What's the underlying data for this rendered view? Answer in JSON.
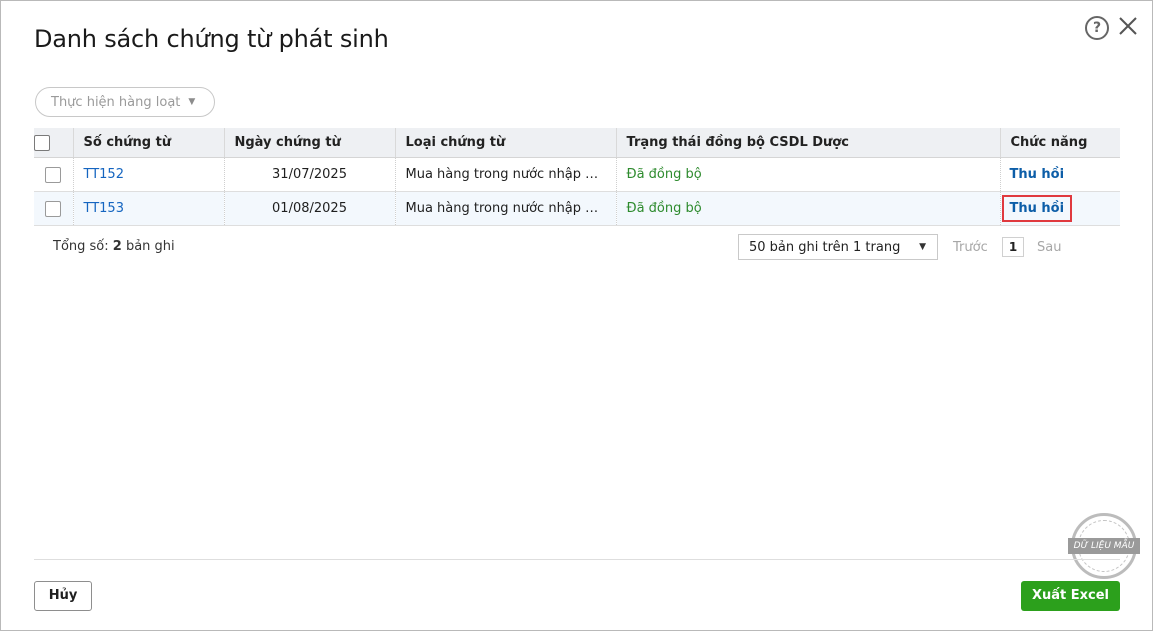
{
  "dialog": {
    "title": "Danh sách chứng từ phát sinh",
    "help_icon": "?",
    "close_icon": "close-icon"
  },
  "toolbar": {
    "bulk_action_label": "Thực hiện hàng loạt"
  },
  "table": {
    "columns": [
      "Số chứng từ",
      "Ngày chứng từ",
      "Loại chứng từ",
      "Trạng thái đồng bộ CSDL Dược",
      "Chức năng"
    ],
    "rows": [
      {
        "number": "TT152",
        "date": "31/07/2025",
        "type": "Mua hàng trong nước nhập kho",
        "status": "Đã đồng bộ",
        "action": "Thu hồi"
      },
      {
        "number": "TT153",
        "date": "01/08/2025",
        "type": "Mua hàng trong nước nhập kho",
        "status": "Đã đồng bộ",
        "action": "Thu hồi"
      }
    ]
  },
  "summary": {
    "total_prefix": "Tổng số:",
    "total_count": "2",
    "total_suffix": "bản ghi"
  },
  "pagination": {
    "page_size_label": "50 bản ghi trên 1 trang",
    "prev_label": "Trước",
    "current_page": "1",
    "next_label": "Sau"
  },
  "watermark": {
    "text": "DỮ LIỆU MẪU"
  },
  "footer": {
    "cancel_label": "Hủy",
    "export_label": "Xuất Excel"
  },
  "colors": {
    "link": "#1565c0",
    "status_ok": "#2e8b2e",
    "primary_button": "#2ca01c",
    "highlight": "#e0393e"
  }
}
